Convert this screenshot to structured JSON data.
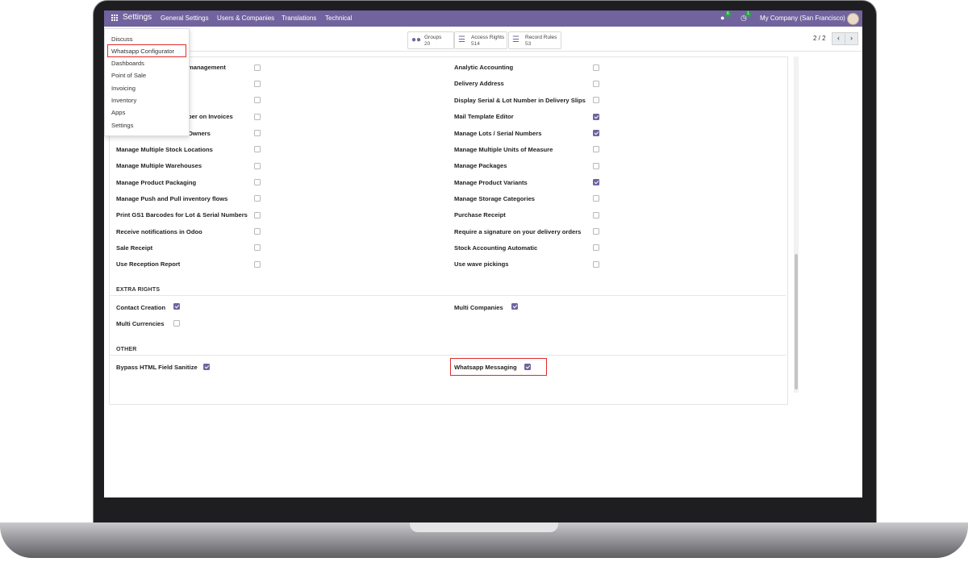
{
  "navbar": {
    "app_title": "Settings",
    "menu": [
      "General Settings",
      "Users & Companies",
      "Translations",
      "Technical"
    ],
    "chat_badge": "6",
    "activity_badge": "1",
    "company": "My Company (San Francisco)",
    "color": "#71639e"
  },
  "dropdown": {
    "items": [
      "Discuss",
      "Whatsapp Configurator",
      "Dashboards",
      "Point of Sale",
      "Invoicing",
      "Inventory",
      "Apps",
      "Settings"
    ],
    "highlighted": "Whatsapp Configurator"
  },
  "stat_buttons": [
    {
      "label": "Groups",
      "value": "20",
      "icon": "users-icon"
    },
    {
      "label": "Access Rights",
      "value": "514",
      "icon": "list-icon"
    },
    {
      "label": "Record Rules",
      "value": "53",
      "icon": "list-icon"
    }
  ],
  "pager": {
    "text": "2 / 2"
  },
  "left_rows": [
    {
      "label": "management",
      "checked": false
    },
    {
      "label": "",
      "checked": false
    },
    {
      "label": "",
      "checked": false
    },
    {
      "label": "ber on Invoices",
      "checked": false
    },
    {
      "label": "Owners",
      "checked": false
    },
    {
      "label": "Manage Multiple Stock Locations",
      "checked": false
    },
    {
      "label": "Manage Multiple Warehouses",
      "checked": false
    },
    {
      "label": "Manage Product Packaging",
      "checked": false
    },
    {
      "label": "Manage Push and Pull inventory flows",
      "checked": false
    },
    {
      "label": "Print GS1 Barcodes for Lot & Serial Numbers",
      "checked": false
    },
    {
      "label": "Receive notifications in Odoo",
      "checked": false
    },
    {
      "label": "Sale Receipt",
      "checked": false
    },
    {
      "label": "Use Reception Report",
      "checked": false
    }
  ],
  "right_rows": [
    {
      "label": "Analytic Accounting",
      "checked": false
    },
    {
      "label": "Delivery Address",
      "checked": false
    },
    {
      "label": "Display Serial & Lot Number in Delivery Slips",
      "checked": false
    },
    {
      "label": "Mail Template Editor",
      "checked": true
    },
    {
      "label": "Manage Lots / Serial Numbers",
      "checked": true
    },
    {
      "label": "Manage Multiple Units of Measure",
      "checked": false
    },
    {
      "label": "Manage Packages",
      "checked": false
    },
    {
      "label": "Manage Product Variants",
      "checked": true
    },
    {
      "label": "Manage Storage Categories",
      "checked": false
    },
    {
      "label": "Purchase Receipt",
      "checked": false
    },
    {
      "label": "Require a signature on your delivery orders",
      "checked": false
    },
    {
      "label": "Stock Accounting Automatic",
      "checked": false
    },
    {
      "label": "Use wave pickings",
      "checked": false
    }
  ],
  "extra_rights": {
    "title": "EXTRA RIGHTS",
    "rows": [
      {
        "label": "Contact Creation",
        "checked": true
      },
      {
        "label": "Multi Companies",
        "checked": true
      },
      {
        "label": "Multi Currencies",
        "checked": false
      }
    ]
  },
  "other": {
    "title": "OTHER",
    "rows": [
      {
        "label": "Bypass HTML Field Sanitize",
        "checked": true
      },
      {
        "label": "Whatsapp Messaging",
        "checked": true
      }
    ]
  }
}
